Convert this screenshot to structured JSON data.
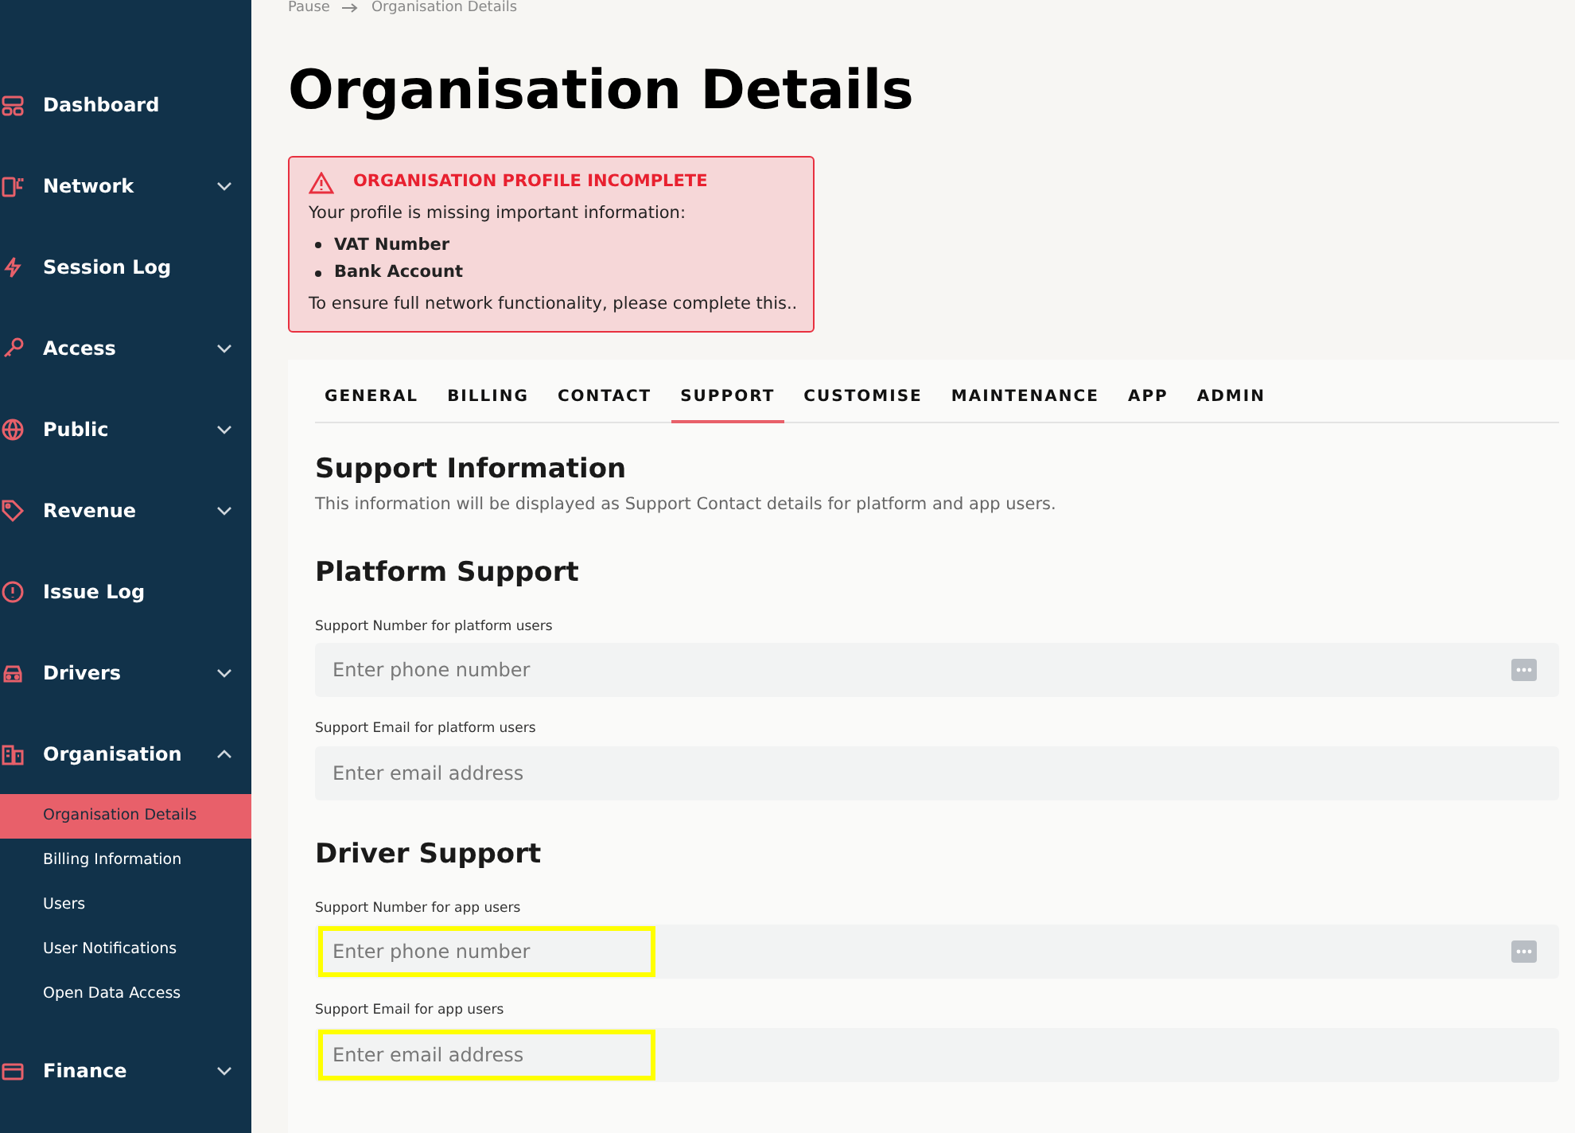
{
  "sidebar": {
    "items": [
      {
        "label": "Dashboard"
      },
      {
        "label": "Network",
        "expanded": false
      },
      {
        "label": "Session Log"
      },
      {
        "label": "Access",
        "expanded": false
      },
      {
        "label": "Public",
        "expanded": false
      },
      {
        "label": "Revenue",
        "expanded": false
      },
      {
        "label": "Issue Log"
      },
      {
        "label": "Drivers",
        "expanded": false
      },
      {
        "label": "Organisation",
        "expanded": true,
        "children": [
          {
            "label": "Organisation Details",
            "selected": true
          },
          {
            "label": "Billing Information",
            "selected": false
          },
          {
            "label": "Users",
            "selected": false
          },
          {
            "label": "User Notifications",
            "selected": false
          },
          {
            "label": "Open Data Access",
            "selected": false
          }
        ]
      },
      {
        "label": "Finance",
        "expanded": false
      }
    ]
  },
  "breadcrumb": [
    "Pause",
    "Organisation Details"
  ],
  "title": "Organisation Details",
  "alert": {
    "title": "ORGANISATION PROFILE INCOMPLETE",
    "intro": "Your profile is missing important information:",
    "items": [
      "VAT Number",
      "Bank Account"
    ],
    "footer": "To ensure full network functionality, please complete this.."
  },
  "tabs": [
    {
      "label": "GENERAL",
      "selected": false
    },
    {
      "label": "BILLING",
      "selected": false
    },
    {
      "label": "CONTACT",
      "selected": false
    },
    {
      "label": "SUPPORT",
      "selected": true
    },
    {
      "label": "CUSTOMISE",
      "selected": false
    },
    {
      "label": "MAINTENANCE",
      "selected": false
    },
    {
      "label": "APP",
      "selected": false
    },
    {
      "label": "ADMIN",
      "selected": false
    }
  ],
  "section": {
    "title": "Support Information",
    "description": "This information will be displayed as Support Contact details for platform and app users."
  },
  "groups": [
    {
      "title": "Platform Support",
      "fields": [
        {
          "kind": "phone",
          "label": "Support Number for platform users",
          "placeholder": "Enter phone number",
          "highlighted": false
        },
        {
          "kind": "email",
          "label": "Support Email for platform users",
          "placeholder": "Enter email address",
          "highlighted": false
        }
      ]
    },
    {
      "title": "Driver Support",
      "fields": [
        {
          "kind": "phone",
          "label": "Support Number for app users",
          "placeholder": "Enter phone number",
          "highlighted": true
        },
        {
          "kind": "email",
          "label": "Support Email for app users",
          "placeholder": "Enter email address",
          "highlighted": true
        }
      ]
    }
  ]
}
